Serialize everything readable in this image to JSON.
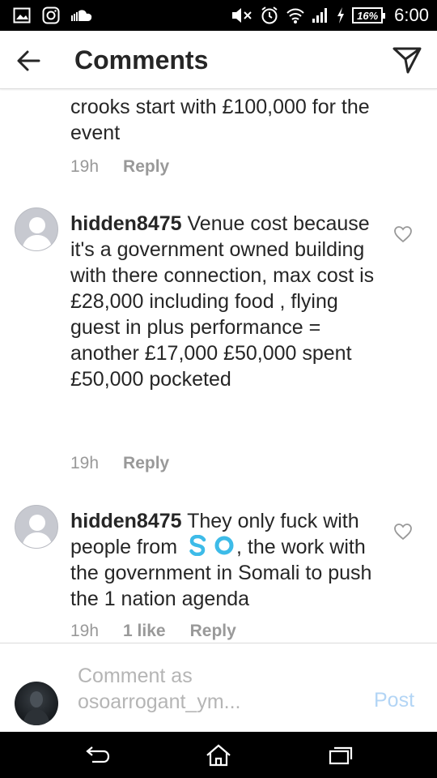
{
  "status_bar": {
    "left_icons": [
      "gallery-icon",
      "instagram-icon",
      "soundcloud-icon"
    ],
    "right_icons": [
      "mute-icon",
      "alarm-icon",
      "wifi-icon",
      "signal-icon",
      "charging-icon"
    ],
    "battery": "16%",
    "time": "6:00"
  },
  "header": {
    "title": "Comments",
    "back_icon": "back-arrow-icon",
    "send_icon": "direct-send-icon"
  },
  "comments": [
    {
      "username": "",
      "text": "crooks start with £100,000 for the event",
      "time": "19h",
      "likes": "",
      "reply_label": "Reply"
    },
    {
      "username": "hidden8475",
      "text": "Venue cost because it's a government owned building with there connection, max cost is £28,000 including food , flying guest in plus performance = another £17,000 £50,000 spent £50,000 pocketed",
      "time": "19h",
      "likes": "",
      "reply_label": "Reply"
    },
    {
      "username": "hidden8475",
      "text_before": "They only fuck with people from",
      "text_after": ", the work with the government in Somali to push the 1 nation agenda",
      "time": "19h",
      "likes": "1 like",
      "reply_label": "Reply"
    }
  ],
  "composer": {
    "placeholder": "Comment as osoarrogant_ym...",
    "post_label": "Post"
  },
  "nav_bar": {
    "icons": [
      "nav-back-icon",
      "home-icon",
      "recent-apps-icon"
    ]
  },
  "colors": {
    "text": "#262626",
    "meta": "#999999",
    "post_disabled": "#b3d5f5",
    "so_logo": "#3dbbe8"
  }
}
